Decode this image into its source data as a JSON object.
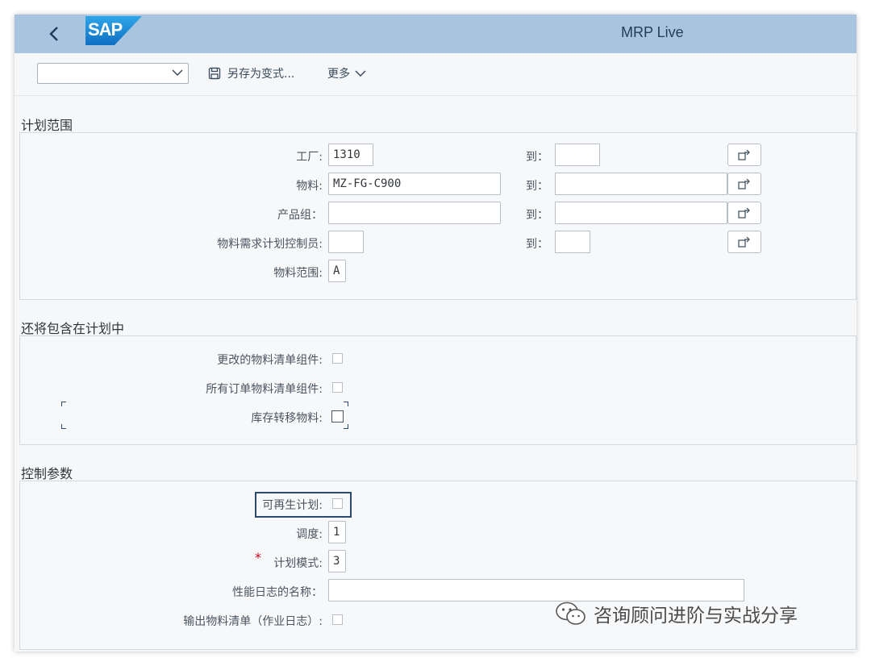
{
  "shell": {
    "title": "MRP Live",
    "logo_text": "SAP",
    "brand_color": "#a8c4de"
  },
  "toolbar": {
    "variant_value": "",
    "save_as_variant": "另存为变式...",
    "more": "更多"
  },
  "section_scope": {
    "title": "计划范围",
    "to_label": "到：",
    "rows": [
      {
        "label": "工厂:",
        "value": "1310",
        "to_value": ""
      },
      {
        "label": "物料:",
        "value": "MZ-FG-C900",
        "to_value": ""
      },
      {
        "label": "产品组：",
        "value": "",
        "to_value": ""
      },
      {
        "label": "物料需求计划控制员:",
        "value": "",
        "to_value": ""
      },
      {
        "label": "物料范围:",
        "value": "A"
      }
    ]
  },
  "section_include": {
    "title": "还将包含在计划中",
    "items": [
      {
        "label": "更改的物料清单组件:",
        "checked": false
      },
      {
        "label": "所有订单物料清单组件:",
        "checked": false
      },
      {
        "label": "库存转移物料:",
        "checked": false
      }
    ]
  },
  "section_control": {
    "title": "控制参数",
    "regen_label": "可再生计划:",
    "regen_checked": false,
    "schedule_label": "调度:",
    "schedule_value": "1",
    "required_mark": "*",
    "plan_mode_label": "计划模式:",
    "plan_mode_value": "3",
    "perf_log_label": "性能日志的名称：",
    "perf_log_value": "",
    "output_bom_label": "输出物料清单（作业日志）:",
    "output_bom_checked": false
  },
  "watermark": {
    "text": "咨询顾问进阶与实战分享"
  }
}
